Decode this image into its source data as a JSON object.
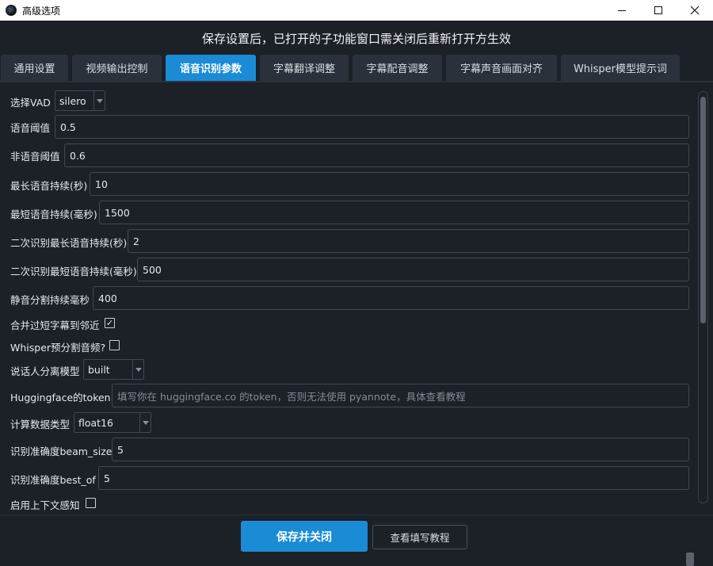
{
  "window": {
    "title": "高级选项"
  },
  "banner": {
    "text": "保存设置后，已打开的子功能窗口需关闭后重新打开方生效"
  },
  "tabs": [
    {
      "label": "通用设置"
    },
    {
      "label": "视频输出控制"
    },
    {
      "label": "语音识别参数",
      "active": true
    },
    {
      "label": "字幕翻译调整"
    },
    {
      "label": "字幕配音调整"
    },
    {
      "label": "字幕声音画面对齐"
    },
    {
      "label": "Whisper模型提示词"
    }
  ],
  "fields": {
    "vad": {
      "label": "选择VAD",
      "value": "silero"
    },
    "speech_threshold": {
      "label": "语音阈值",
      "value": "0.5"
    },
    "nonspeech_threshold": {
      "label": "非语音阈值",
      "value": "0.6"
    },
    "max_speech_sec": {
      "label": "最长语音持续(秒)",
      "value": "10"
    },
    "min_speech_ms": {
      "label": "最短语音持续(毫秒)",
      "value": "1500"
    },
    "second_max_speech_sec": {
      "label": "二次识别最长语音持续(秒)",
      "value": "2"
    },
    "second_min_speech_ms": {
      "label": "二次识别最短语音持续(毫秒)",
      "value": "500"
    },
    "silence_split_ms": {
      "label": "静音分割持续毫秒",
      "value": "400"
    },
    "merge_short": {
      "label": "合并过短字幕到邻近",
      "checked": true
    },
    "whisper_presplit": {
      "label": "Whisper预分割音频?",
      "checked": false
    },
    "diarization_model": {
      "label": "说话人分离模型",
      "value": "built"
    },
    "hf_token": {
      "label": "Huggingface的token",
      "value": "",
      "placeholder": "填写你在 huggingface.co 的token，否则无法使用 pyannote，具体查看教程"
    },
    "compute_type": {
      "label": "计算数据类型",
      "value": "float16"
    },
    "beam_size": {
      "label": "识别准确度beam_size",
      "value": "5"
    },
    "best_of": {
      "label": "识别准确度best_of",
      "value": "5"
    },
    "context_aware": {
      "label": "启用上下文感知",
      "checked": false
    }
  },
  "footer": {
    "save_label": "保存并关闭",
    "tutorial_label": "查看填写教程"
  },
  "colors": {
    "accent": "#1b8bd6",
    "background": "#1c2128",
    "tab_inactive": "#2b313a"
  },
  "icons": {
    "app": "app-logo-icon",
    "minimize": "minimize-icon",
    "maximize": "maximize-icon",
    "close": "close-icon"
  }
}
